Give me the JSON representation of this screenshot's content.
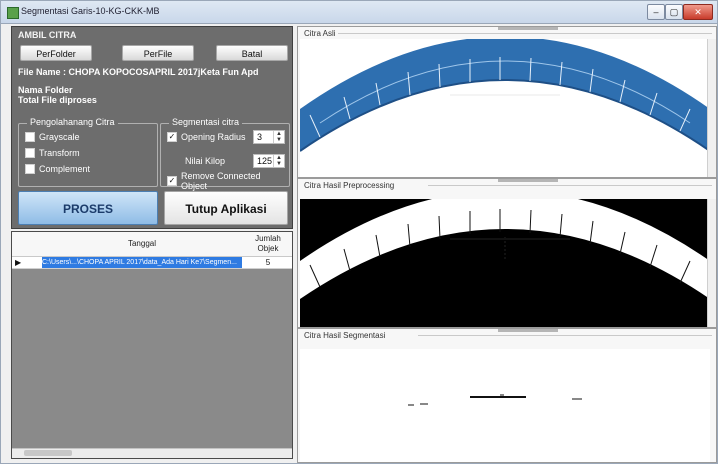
{
  "window": {
    "title": "Segmentasi Garis-10-KG-CKK-MB",
    "min_label": "–",
    "max_label": "▢",
    "close_label": "✕"
  },
  "ambil": {
    "title": "AMBIL CITRA",
    "per_folder": "PerFolder",
    "per_file": "PerFile",
    "batal": "Batal",
    "file_name_label": "File Name : CHOPA KOPOCOSAPRIL 2017jKeta Fun Apd",
    "nama_folder": "Nama Folder",
    "total_file": "Total File diproses"
  },
  "preprocessing": {
    "title": "Pengolahanang Citra",
    "items": [
      "Grayscale",
      "Transform",
      "Complement"
    ]
  },
  "segmentasi": {
    "title": "Segmentasi citra",
    "opening_label": "Opening Radius",
    "opening_value": "3",
    "nilai_label": "Nilai Kilop",
    "nilai_value": "125",
    "remove_label": "Remove Connected Object"
  },
  "buttons": {
    "proses": "PROSES",
    "tutup": "Tutup Aplikasi"
  },
  "table": {
    "col_tanggal": "Tanggal",
    "col_jumlah": "Jumlah Objek",
    "row_marker": "▶",
    "rows": [
      {
        "tanggal": "C:\\Users\\...\\CHOPA APRIL 2017\\data_Ada Hari Ke7\\Segmen...",
        "jumlah": "5"
      }
    ]
  },
  "panels": {
    "citra_asli": "Citra Asli",
    "hasil_preprocessing": "Citra Hasil Preprocessing",
    "hasil_segmentasi": "Citra Hasil Segmentasi"
  },
  "colors": {
    "accent_blue": "#2f7be2",
    "image_blue": "#2e6fb0",
    "panel_gray": "#6d6d6d"
  }
}
